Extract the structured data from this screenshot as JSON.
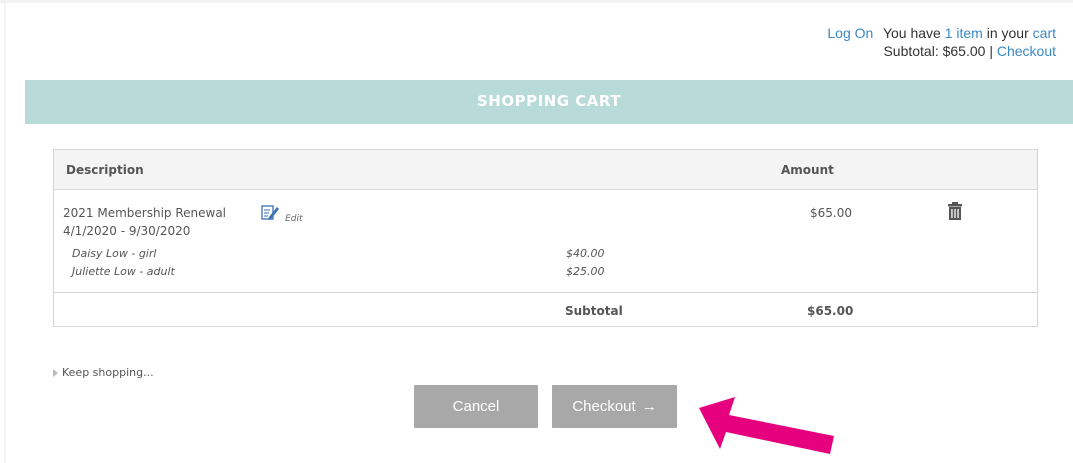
{
  "header": {
    "log_on": "Log On",
    "cart_prefix": "You have",
    "item_count_text": "1 item",
    "in_your": "in your",
    "cart_link": "cart",
    "subtotal_label": "Subtotal: $65.00 |",
    "checkout_link": "Checkout"
  },
  "banner": {
    "title": "SHOPPING CART"
  },
  "table": {
    "col_description": "Description",
    "col_amount": "Amount",
    "item": {
      "name": "2021 Membership Renewal",
      "edit_label": "Edit",
      "dates": "4/1/2020 - 9/30/2020",
      "amount": "$65.00",
      "sub_items": [
        {
          "name": "Daisy Low - girl",
          "price": "$40.00"
        },
        {
          "name": "Juliette Low - adult",
          "price": "$25.00"
        }
      ]
    },
    "subtotal_label": "Subtotal",
    "subtotal_value": "$65.00"
  },
  "keep_shopping": "Keep shopping...",
  "buttons": {
    "cancel": "Cancel",
    "checkout": "Checkout",
    "checkout_arrow": "→"
  },
  "colors": {
    "banner": "#b8dad8",
    "link": "#3a88c5",
    "button": "#a8a8a8",
    "annotation_arrow": "#e6007e"
  },
  "icons": [
    "edit-icon",
    "trash-icon",
    "caret-right-icon",
    "arrow-right-icon"
  ]
}
